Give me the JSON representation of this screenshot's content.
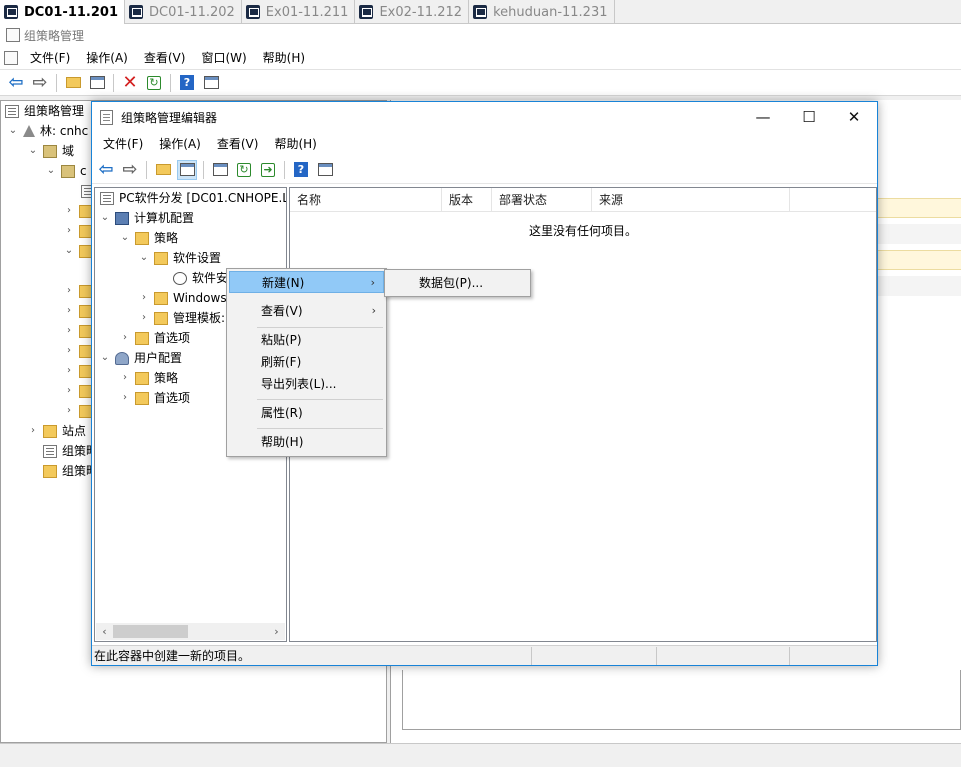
{
  "remote_tabs": [
    {
      "label": "DC01-11.201",
      "active": true
    },
    {
      "label": "DC01-11.202",
      "active": false
    },
    {
      "label": "Ex01-11.211",
      "active": false
    },
    {
      "label": "Ex02-11.212",
      "active": false
    },
    {
      "label": "kehuduan-11.231",
      "active": false
    }
  ],
  "background_window": {
    "title": "组策略管理",
    "menu": [
      "文件(F)",
      "操作(A)",
      "查看(V)",
      "窗口(W)",
      "帮助(H)"
    ],
    "tree": [
      {
        "label": "组策略管理",
        "icon": "gpmc-icon"
      },
      {
        "label": "林: cnhc",
        "icon": "forest-icon"
      },
      {
        "label": "域",
        "icon": "folder-icon"
      },
      {
        "label": "c",
        "icon": "domain-icon"
      },
      {
        "label": "站点",
        "icon": "folder-icon"
      },
      {
        "label": "组策略",
        "icon": "gpmc-icon"
      },
      {
        "label": "组策略",
        "icon": "gpmc-icon"
      }
    ]
  },
  "editor": {
    "title": "组策略管理编辑器",
    "menu": [
      "文件(F)",
      "操作(A)",
      "查看(V)",
      "帮助(H)"
    ],
    "window_buttons": {
      "minimize": "—",
      "maximize": "☐",
      "close": "✕"
    },
    "tree": [
      {
        "label": "PC软件分发 [DC01.CNHOPE.L",
        "icon": "gpo-icon"
      },
      {
        "label": "计算机配置",
        "icon": "computer-icon",
        "expander": "⌄"
      },
      {
        "label": "策略",
        "icon": "folder-icon",
        "expander": "⌄"
      },
      {
        "label": "软件设置",
        "icon": "folder-icon",
        "expander": "⌄"
      },
      {
        "label": "软件安",
        "icon": "software-install-icon",
        "expander": ""
      },
      {
        "label": "Windows",
        "icon": "folder-icon",
        "expander": "›"
      },
      {
        "label": "管理模板:",
        "icon": "folder-icon",
        "expander": "›"
      },
      {
        "label": "首选项",
        "icon": "folder-icon",
        "expander": "›"
      },
      {
        "label": "用户配置",
        "icon": "user-icon",
        "expander": "⌄"
      },
      {
        "label": "策略",
        "icon": "folder-icon",
        "expander": "›"
      },
      {
        "label": "首选项",
        "icon": "folder-icon",
        "expander": "›"
      }
    ],
    "columns": [
      "名称",
      "版本",
      "部署状态",
      "来源"
    ],
    "empty_text": "这里没有任何项目。",
    "status_text": "在此容器中创建一新的项目。"
  },
  "context_menu": {
    "items": [
      {
        "label": "新建(N)",
        "submenu": true,
        "highlighted": true
      },
      {
        "label": "查看(V)",
        "submenu": true,
        "highlighted": false
      },
      {
        "label": "粘贴(P)",
        "submenu": false,
        "highlighted": false
      },
      {
        "label": "刷新(F)",
        "submenu": false,
        "highlighted": false
      },
      {
        "label": "导出列表(L)...",
        "submenu": false,
        "highlighted": false
      },
      {
        "label": "属性(R)",
        "submenu": false,
        "highlighted": false
      },
      {
        "label": "帮助(H)",
        "submenu": false,
        "highlighted": false
      }
    ],
    "submenu_items": [
      "数据包(P)..."
    ]
  },
  "colors": {
    "accent_border": "#1883d7",
    "menu_highlight": "#91c9f7",
    "folder": "#f3c95b",
    "band_yellow": "#fff7dc"
  }
}
